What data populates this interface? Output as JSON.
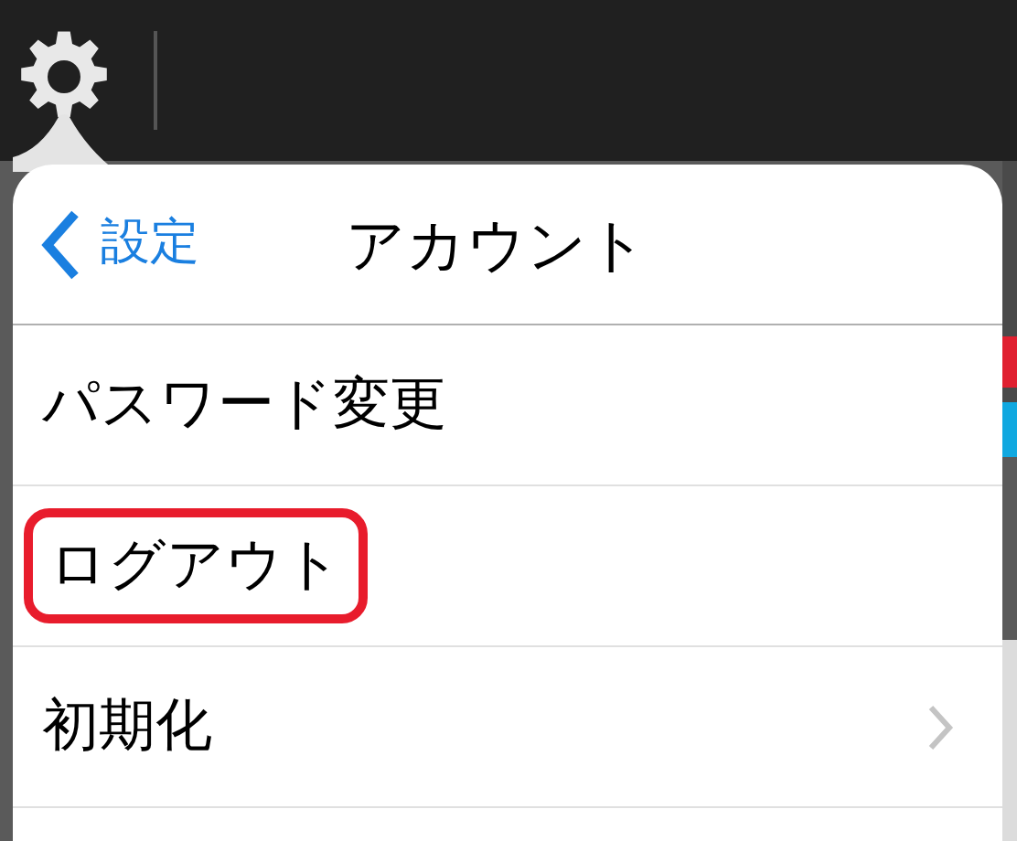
{
  "popover": {
    "back_button": "設定",
    "title": "アカウント",
    "items": [
      {
        "label": "パスワード変更",
        "highlighted": false,
        "chevron": false
      },
      {
        "label": "ログアウト",
        "highlighted": true,
        "chevron": false
      },
      {
        "label": "初期化",
        "highlighted": false,
        "chevron": true
      }
    ]
  }
}
